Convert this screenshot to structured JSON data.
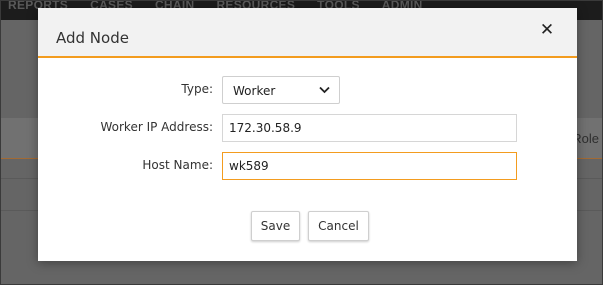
{
  "background": {
    "nav_items": [
      "REPORTS",
      "CASES",
      "CHAIN",
      "RESOURCES",
      "TOOLS",
      "ADMIN"
    ],
    "column_label": "Role"
  },
  "dialog": {
    "title": "Add Node",
    "close_glyph": "✕",
    "fields": {
      "type": {
        "label": "Type:",
        "value": "Worker",
        "icon": "chevron-down-icon"
      },
      "worker_ip": {
        "label": "Worker IP Address:",
        "value": "172.30.58.9"
      },
      "host_name": {
        "label": "Host Name:",
        "value": "wk589"
      }
    },
    "buttons": {
      "save": "Save",
      "cancel": "Cancel"
    },
    "accent_color": "#f39c1f"
  }
}
